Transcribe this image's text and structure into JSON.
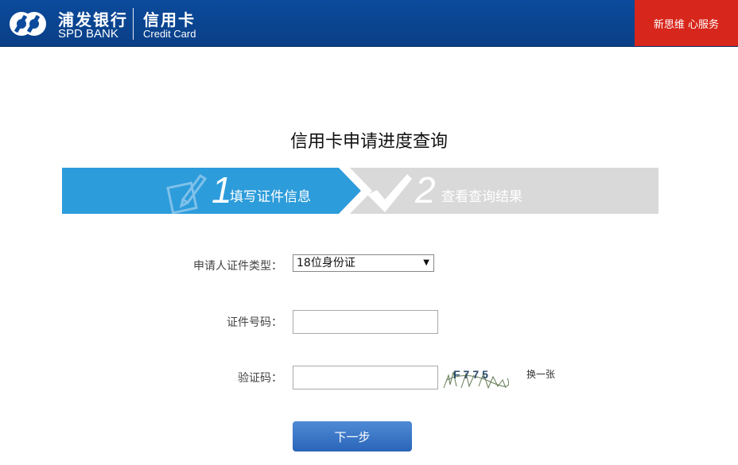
{
  "header": {
    "brand_cn": "浦发银行",
    "brand_en": "SPD BANK",
    "product_cn": "信用卡",
    "product_en": "Credit Card",
    "slogan": "新思维 心服务",
    "colors": {
      "header_bg": "#0b4a9c",
      "slogan_bg": "#d7261b"
    }
  },
  "page": {
    "title": "信用卡申请进度查询"
  },
  "steps": [
    {
      "number": "1",
      "label": "填写证件信息",
      "icon": "pencil-document-icon",
      "active": true,
      "color": "#2d9cdb"
    },
    {
      "number": "2",
      "label": "查看查询结果",
      "icon": "checkmark-icon",
      "active": false,
      "color": "#d9d9d9"
    }
  ],
  "form": {
    "id_type_label": "申请人证件类型：",
    "id_type_value": "18位身份证",
    "id_number_label": "证件号码：",
    "id_number_value": "",
    "captcha_label": "验证码：",
    "captcha_value": "",
    "captcha_text": "F775",
    "refresh_label": "换一张",
    "next_label": "下一步"
  }
}
